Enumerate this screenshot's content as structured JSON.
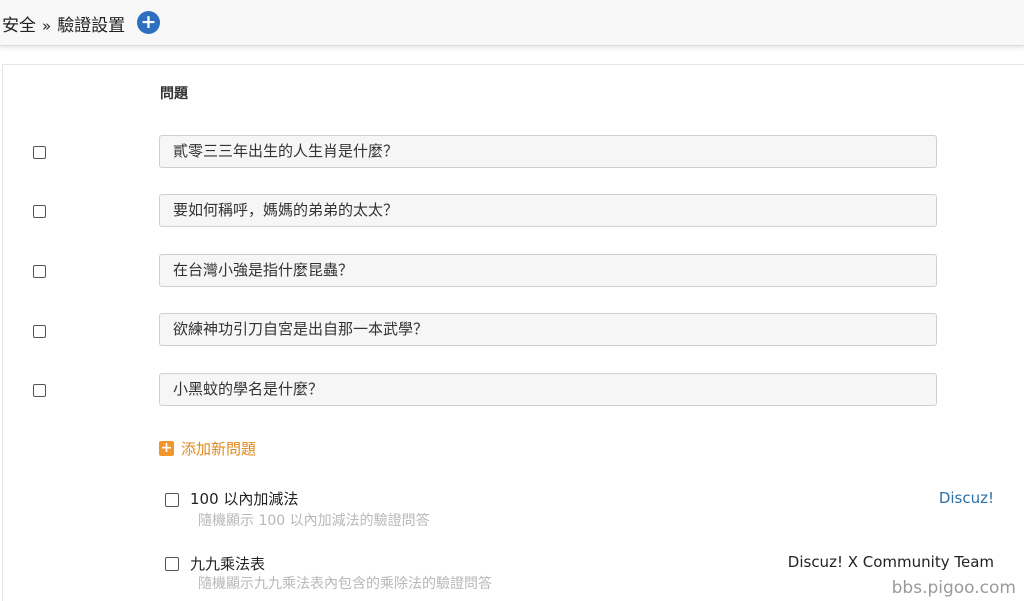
{
  "header": {
    "breadcrumb_root": "安全",
    "breadcrumb_sep": "»",
    "breadcrumb_current": "驗證設置",
    "add_icon": "plus-circle-icon"
  },
  "questions": {
    "column_header": "問題",
    "items": [
      {
        "text": "貳零三三年出生的人生肖是什麼？"
      },
      {
        "text": "要如何稱呼，媽媽的弟弟的太太？"
      },
      {
        "text": "在台灣小強是指什麼昆蟲？"
      },
      {
        "text": "欲練神功引刀自宮是出自那一本武學？"
      },
      {
        "text": "小黑蚊的學名是什麼？"
      }
    ],
    "add_new_label": "添加新問題",
    "add_new_icon": "plus-square-icon"
  },
  "plugins": [
    {
      "name": "100 以內加減法",
      "desc": "隨機顯示 100 以內加減法的驗證問答",
      "author": "Discuz!",
      "author_color": "#2e6fa8"
    },
    {
      "name": "九九乘法表",
      "desc": "隨機顯示九九乘法表內包含的乘除法的驗證問答",
      "author": "Discuz! X Community Team",
      "author_color": "#222222"
    }
  ],
  "watermark": "bbs.pigoo.com",
  "colors": {
    "accent_blue": "#2e6fbf",
    "accent_orange": "#f0962c"
  }
}
